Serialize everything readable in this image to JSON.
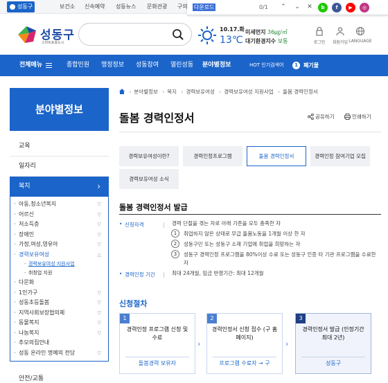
{
  "topbar": {
    "home_label": "성동구청",
    "links": [
      "보건소",
      "신속예약",
      "성동뉴스",
      "문화관광",
      "구의"
    ]
  },
  "findbar": {
    "query": "다운로드",
    "count": "0/1"
  },
  "header": {
    "logo_name": "성동구",
    "logo_sub": "스마트포용도시",
    "date": "10.17.화",
    "temp": "13℃",
    "dust_label": "미세먼지",
    "dust_value": "36㎍/㎥",
    "air_label": "대기환경지수",
    "air_value": "보통",
    "util": [
      "로그인",
      "회원가입",
      "LANGUAGE"
    ]
  },
  "nav": {
    "all_label": "전체메뉴",
    "items": [
      "종합민원",
      "행정정보",
      "성동참여",
      "열린성동",
      "분야별정보"
    ],
    "hot_label": "HOT 인기검색어",
    "hot_num": "1",
    "hot_keyword": "폐기물"
  },
  "sidebar": {
    "title": "분야별정보",
    "top": [
      "교육",
      "일자리",
      "복지"
    ],
    "sub": [
      "아동,청소년복지",
      "어르신",
      "저소득층",
      "장애인",
      "가정,여성,영유아",
      "경력보유여성"
    ],
    "subsub": [
      "경력보유여성 지원사업",
      "취창업 지원"
    ],
    "more": [
      "다문화",
      "1인가구",
      "성동초등돌봄",
      "지역사회보장협의체",
      "동물복지",
      "나눔복지",
      "추모의집안내",
      "성동 온라인 명예의 전당"
    ],
    "bottom": "안전/교통"
  },
  "breadcrumb": [
    "분야별정보",
    "복지",
    "경력보유여성",
    "경력보유여성 지원사업",
    "돌봄 경력인정서"
  ],
  "page": {
    "title": "돌봄 경력인정서",
    "share": "공유하기",
    "print": "인쇄하기"
  },
  "tabs": [
    "경력보유여성이란?",
    "경력인정프로그램",
    "돌봄 경력인정서",
    "경력인정 참여기업 모집",
    "경력보유여성 소식"
  ],
  "section": {
    "title": "돌봄 경력인정서 발급",
    "qual_label": "신청자격",
    "qual_text": "경력 단절을 겪는 자로 아래 기준을 모두 충족한 자",
    "conds": [
      "취업하지 않은 상태로 무급 돌봄노동을 1개월 이상 한 자",
      "성동구민 또는 성동구 소재 기업에 취업을 희망하는 자",
      "성동구 경력인정 프로그램을 80%이상 수료 또는 성동구 인증 타 기관 프로그램을 수료한 자"
    ],
    "period_label": "경력인정 기간",
    "period_text": "최대 24개월, 임금 반영기간: 최대 12개월"
  },
  "procedure": {
    "title": "신청절차",
    "steps": [
      {
        "num": "1",
        "title": "경력인정 프로그램 신청 및 수료",
        "bottom": "돌봄경력 보유자"
      },
      {
        "num": "2",
        "title": "경력인정서 신청 접수 (구 홈페이지)",
        "bottom": "프로그램 수료자 → 구"
      },
      {
        "num": "3",
        "title": "경력인정서 발급 (인정기간 최대 2년)",
        "bottom": "성동구"
      }
    ]
  },
  "colors": {
    "brand": "#1b64c9",
    "nav": "#1b64c9"
  }
}
